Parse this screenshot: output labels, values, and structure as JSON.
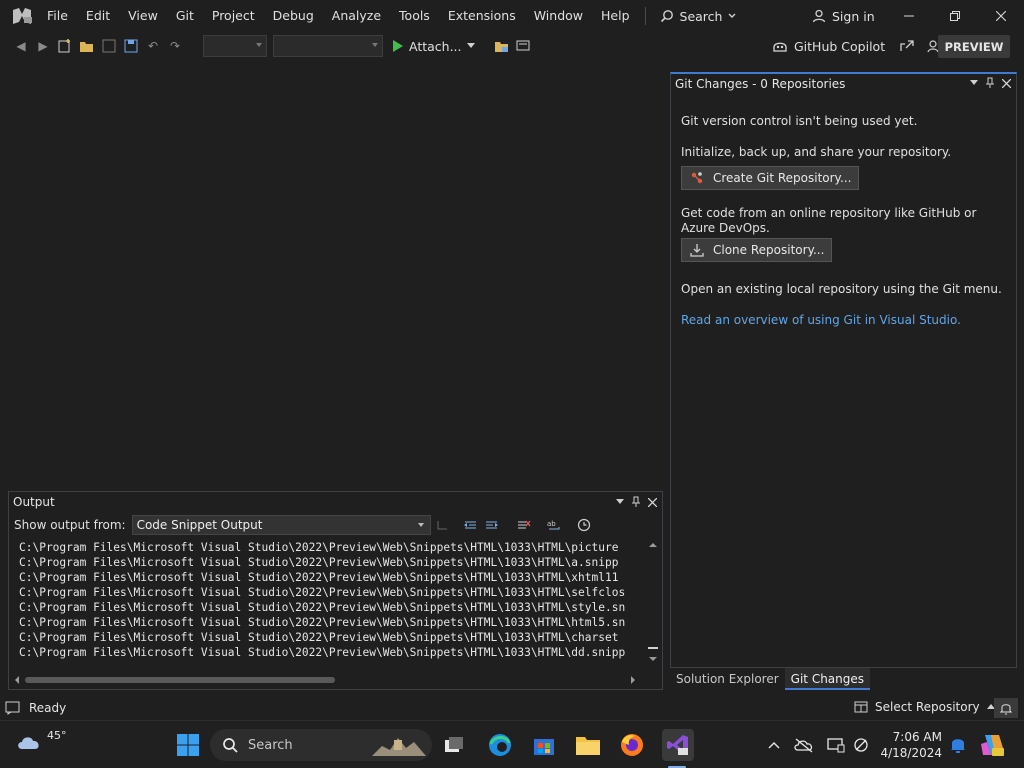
{
  "menu": {
    "items": [
      "File",
      "Edit",
      "View",
      "Git",
      "Project",
      "Debug",
      "Analyze",
      "Tools",
      "Extensions",
      "Window",
      "Help"
    ],
    "search_label": "Search",
    "signin_label": "Sign in"
  },
  "toolbar": {
    "attach_label": "Attach...",
    "copilot_label": "GitHub Copilot",
    "preview_label": "PREVIEW"
  },
  "git_panel": {
    "title": "Git Changes - 0 Repositories",
    "not_used": "Git version control isn't being used yet.",
    "init_text": "Initialize, back up, and share your repository.",
    "create_button": "Create Git Repository...",
    "get_code_text": "Get code from an online repository like GitHub or Azure DevOps.",
    "clone_button": "Clone Repository...",
    "open_text": "Open an existing local repository using the Git menu.",
    "overview_link": "Read an overview of using Git in Visual Studio."
  },
  "right_tabs": [
    "Solution Explorer",
    "Git Changes"
  ],
  "output": {
    "title": "Output",
    "show_from_label": "Show output from:",
    "source": "Code Snippet Output",
    "lines": [
      "C:\\Program Files\\Microsoft Visual Studio\\2022\\Preview\\Web\\Snippets\\HTML\\1033\\HTML\\picture",
      "C:\\Program Files\\Microsoft Visual Studio\\2022\\Preview\\Web\\Snippets\\HTML\\1033\\HTML\\a.snipp",
      "C:\\Program Files\\Microsoft Visual Studio\\2022\\Preview\\Web\\Snippets\\HTML\\1033\\HTML\\xhtml11",
      "C:\\Program Files\\Microsoft Visual Studio\\2022\\Preview\\Web\\Snippets\\HTML\\1033\\HTML\\selfclos",
      "C:\\Program Files\\Microsoft Visual Studio\\2022\\Preview\\Web\\Snippets\\HTML\\1033\\HTML\\style.sn",
      "C:\\Program Files\\Microsoft Visual Studio\\2022\\Preview\\Web\\Snippets\\HTML\\1033\\HTML\\html5.sn",
      "C:\\Program Files\\Microsoft Visual Studio\\2022\\Preview\\Web\\Snippets\\HTML\\1033\\HTML\\charset",
      "C:\\Program Files\\Microsoft Visual Studio\\2022\\Preview\\Web\\Snippets\\HTML\\1033\\HTML\\dd.snipp"
    ]
  },
  "status": {
    "ready": "Ready",
    "select_repo": "Select Repository"
  },
  "taskbar": {
    "weather_temp": "45°",
    "search_label": "Search",
    "time": "7:06 AM",
    "date": "4/18/2024"
  },
  "colors": {
    "accent": "#3e7bd1",
    "link": "#5fa7e8",
    "vs_purple": "#8a4fd8",
    "play_green": "#3fbf4e"
  }
}
